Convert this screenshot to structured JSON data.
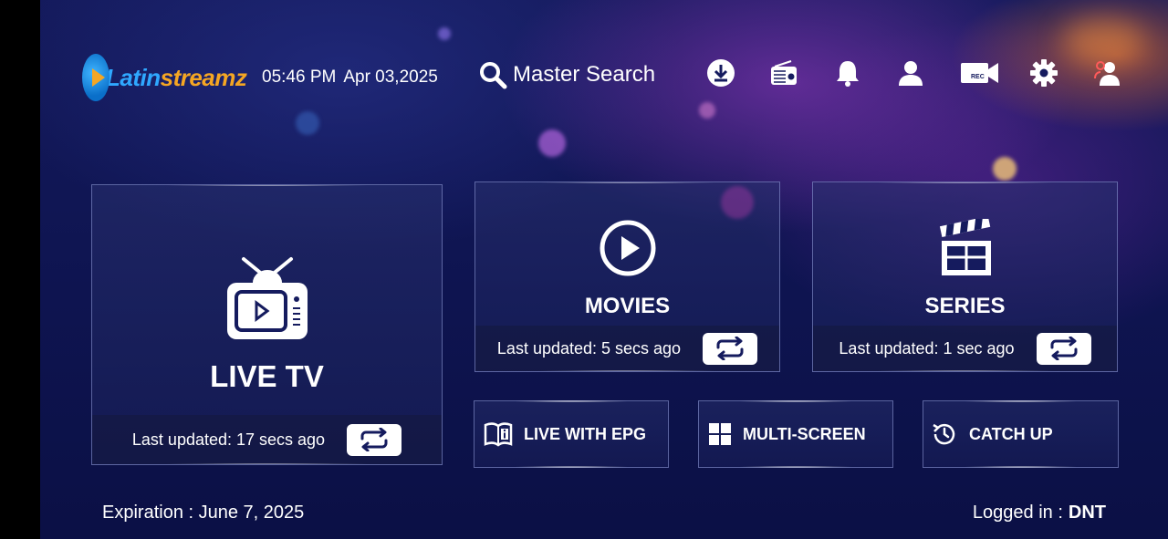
{
  "brand": {
    "name_part1": "Latin",
    "name_part2": "streamz",
    "color_blue": "#2fa8ff",
    "color_orange": "#f5a623"
  },
  "header": {
    "time": "05:46 PM",
    "date": "Apr 03,2025",
    "search_label": "Master Search",
    "icons": [
      "download-icon",
      "radio-icon",
      "notification-bell-icon",
      "account-icon",
      "record-icon",
      "settings-gear-icon",
      "switch-user-icon"
    ],
    "rec_badge": "REC"
  },
  "cards": {
    "live_tv": {
      "title": "LIVE TV",
      "updated": "Last updated: 17 secs ago",
      "icon": "tv-icon"
    },
    "movies": {
      "title": "MOVIES",
      "updated": "Last updated: 5 secs ago",
      "icon": "play-circle-icon"
    },
    "series": {
      "title": "SERIES",
      "updated": "Last updated: 1 sec ago",
      "icon": "clapperboard-icon"
    }
  },
  "small_cards": {
    "epg": {
      "label": "LIVE WITH EPG",
      "icon": "book-guide-icon"
    },
    "multi": {
      "label": "MULTI-SCREEN",
      "icon": "grid-icon"
    },
    "catchup": {
      "label": "CATCH UP",
      "icon": "history-icon"
    }
  },
  "footer": {
    "expiration": "Expiration : June 7, 2025",
    "logged_label": "Logged in :",
    "user": "DNT"
  }
}
